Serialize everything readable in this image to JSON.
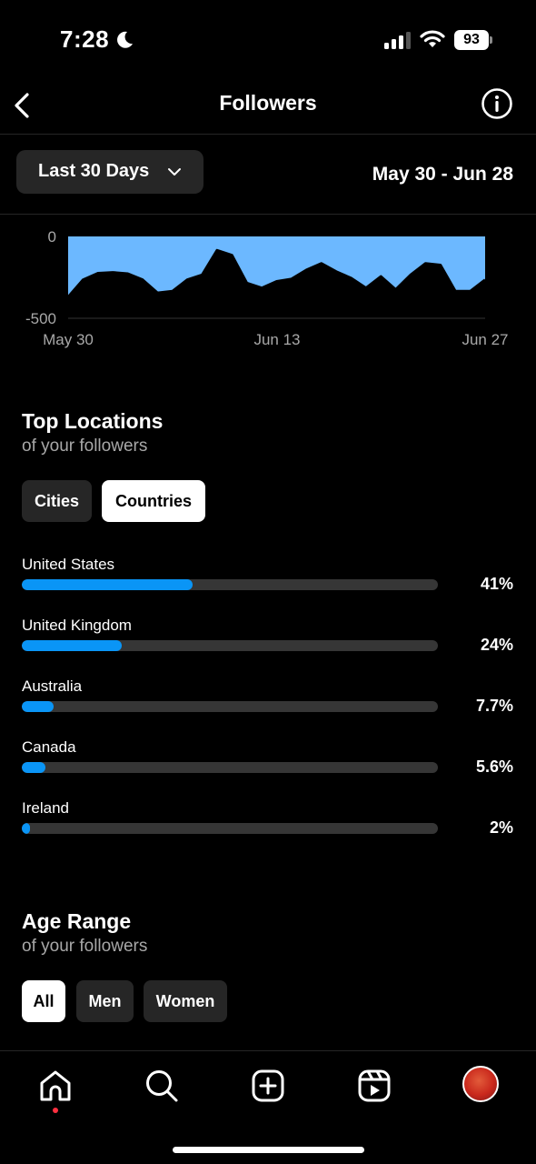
{
  "status_bar": {
    "time": "7:28",
    "battery": "93"
  },
  "header": {
    "title": "Followers"
  },
  "range": {
    "selector_label": "Last 30 Days",
    "date_range": "May 30 - Jun 28"
  },
  "chart_data": {
    "type": "area",
    "x_tick_labels": [
      "May 30",
      "Jun 13",
      "Jun 27"
    ],
    "y_tick_labels": [
      "0",
      "-500"
    ],
    "ylim": [
      -500,
      0
    ],
    "values": [
      -370,
      -265,
      -225,
      -220,
      -228,
      -265,
      -345,
      -335,
      -265,
      -235,
      -85,
      -115,
      -285,
      -315,
      -275,
      -260,
      -205,
      -165,
      -215,
      -255,
      -315,
      -245,
      -325,
      -235,
      -165,
      -175,
      -335,
      -335,
      -265
    ],
    "fill_color": "#6cb8ff",
    "line_color": "#000000"
  },
  "locations": {
    "title": "Top Locations",
    "subtitle": "of your followers",
    "tabs": [
      {
        "label": "Cities",
        "active": false
      },
      {
        "label": "Countries",
        "active": true
      }
    ],
    "items": [
      {
        "name": "United States",
        "value": "41%",
        "fraction": 0.41
      },
      {
        "name": "United Kingdom",
        "value": "24%",
        "fraction": 0.24
      },
      {
        "name": "Australia",
        "value": "7.7%",
        "fraction": 0.077
      },
      {
        "name": "Canada",
        "value": "5.6%",
        "fraction": 0.056
      },
      {
        "name": "Ireland",
        "value": "2%",
        "fraction": 0.02
      }
    ]
  },
  "age": {
    "title": "Age Range",
    "subtitle": "of your followers",
    "tabs": [
      {
        "label": "All",
        "active": true
      },
      {
        "label": "Men",
        "active": false
      },
      {
        "label": "Women",
        "active": false
      }
    ]
  },
  "nav": {
    "icons": [
      "home-icon",
      "search-icon",
      "create-icon",
      "reels-icon",
      "profile-avatar"
    ]
  }
}
